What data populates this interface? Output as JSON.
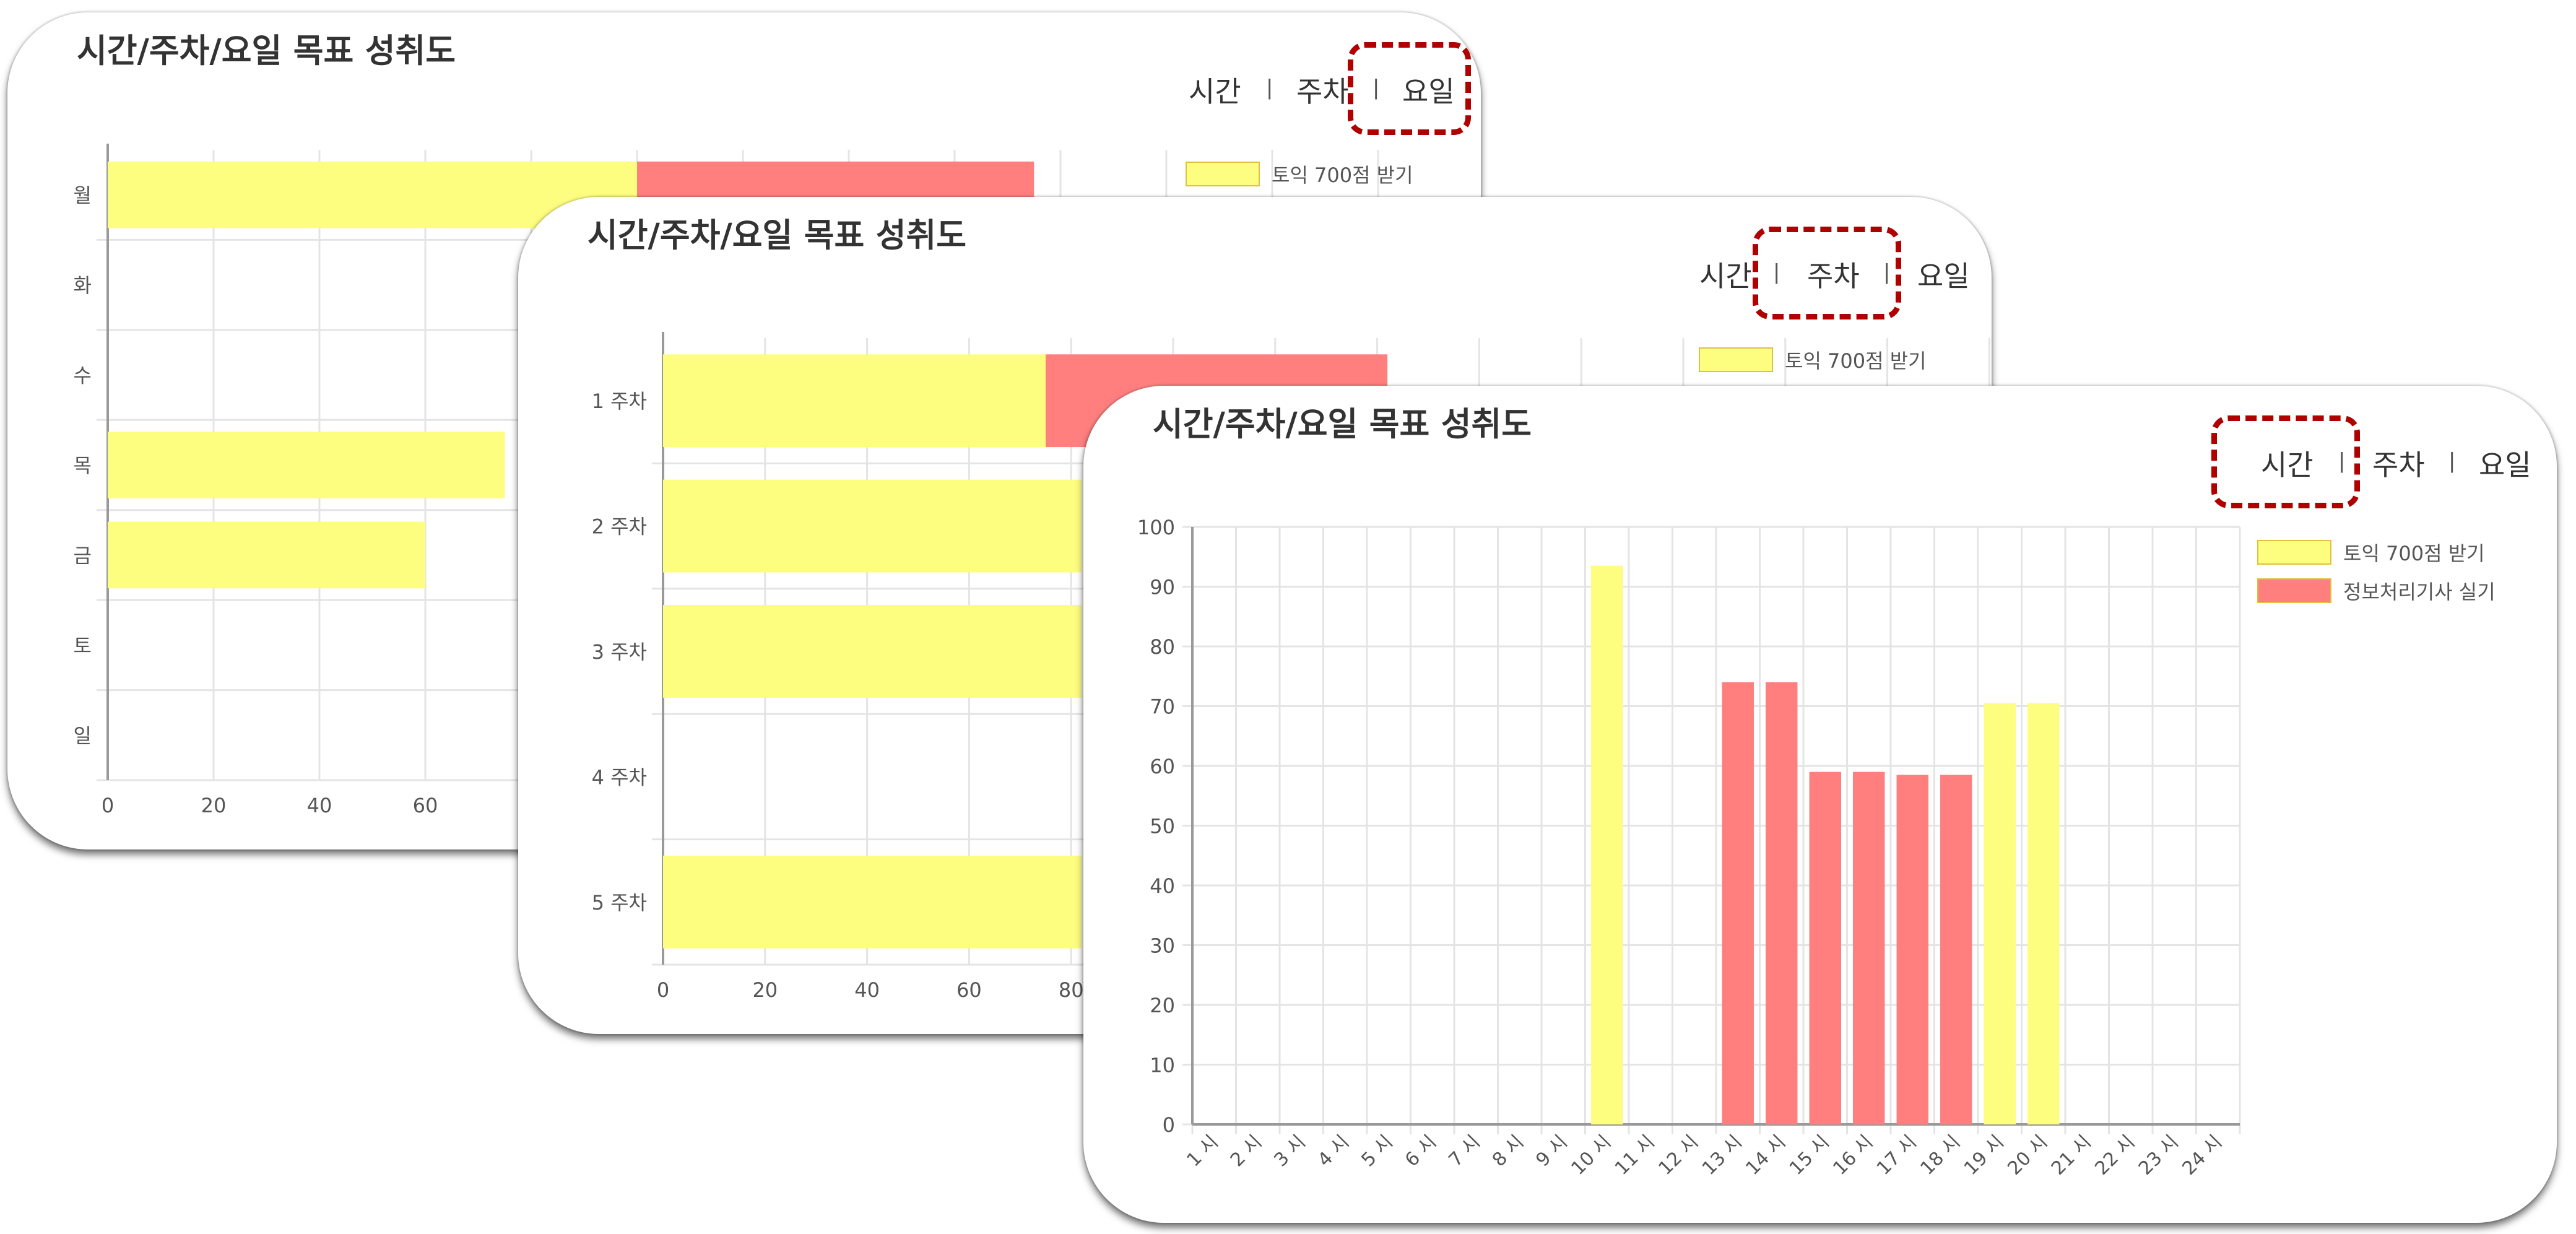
{
  "tabs": [
    "시간",
    "주차",
    "요일"
  ],
  "tab_separator": "|",
  "series": [
    {
      "name": "토익 700점 받기",
      "color": "#fdfd7f"
    },
    {
      "name": "정보처리기사 실기",
      "color": "#ff7f7f"
    }
  ],
  "cards": [
    {
      "title": "시간/주차/요일 목표 성취도",
      "active_tab": "요일"
    },
    {
      "title": "시간/주차/요일 목표 성취도",
      "active_tab": "주차"
    },
    {
      "title": "시간/주차/요일 목표 성취도",
      "active_tab": "시간"
    }
  ],
  "chart_data": [
    {
      "type": "bar",
      "orientation": "horizontal",
      "stacked": true,
      "categories": [
        "월",
        "화",
        "수",
        "목",
        "금",
        "토",
        "일"
      ],
      "series": [
        {
          "name": "토익 700점 받기",
          "values": [
            100,
            null,
            null,
            75,
            60,
            null,
            null
          ]
        },
        {
          "name": "정보처리기사 실기",
          "values": [
            75,
            null,
            null,
            null,
            null,
            null,
            null
          ]
        }
      ],
      "x_tick_labels": [
        "0",
        "20",
        "40",
        "60"
      ],
      "grid": true,
      "legend": "right",
      "note": "partially hidden by overlapping card"
    },
    {
      "type": "bar",
      "orientation": "horizontal",
      "stacked": true,
      "categories": [
        "1 주차",
        "2 주차",
        "3 주차",
        "4 주차",
        "5 주차"
      ],
      "series": [
        {
          "name": "토익 700점 받기",
          "values": [
            75,
            82,
            82,
            null,
            82
          ]
        },
        {
          "name": "정보처리기사 실기",
          "values": [
            67,
            null,
            null,
            null,
            null
          ]
        }
      ],
      "x_tick_labels": [
        "0",
        "20",
        "40",
        "60",
        "80"
      ],
      "grid": true,
      "legend": "right",
      "note": "partially hidden by overlapping card"
    },
    {
      "type": "bar",
      "orientation": "vertical",
      "categories": [
        "1 시",
        "2 시",
        "3 시",
        "4 시",
        "5 시",
        "6 시",
        "7 시",
        "8 시",
        "9 시",
        "10 시",
        "11 시",
        "12 시",
        "13 시",
        "14 시",
        "15 시",
        "16 시",
        "17 시",
        "18 시",
        "19 시",
        "20 시",
        "21 시",
        "22 시",
        "23 시",
        "24 시"
      ],
      "series": [
        {
          "name": "토익 700점 받기",
          "values": [
            0,
            0,
            0,
            0,
            0,
            0,
            0,
            0,
            0,
            93.5,
            0,
            0,
            0,
            0,
            0,
            0,
            0,
            0,
            70.5,
            70.5,
            0,
            0,
            0,
            0
          ]
        },
        {
          "name": "정보처리기사 실기",
          "values": [
            0,
            0,
            0,
            0,
            0,
            0,
            0,
            0,
            0,
            0,
            0,
            0,
            74,
            74,
            59,
            59,
            58.5,
            58.5,
            0,
            0,
            0,
            0,
            0,
            0
          ]
        }
      ],
      "ylim": [
        0,
        100
      ],
      "y_ticks": [
        0,
        10,
        20,
        30,
        40,
        50,
        60,
        70,
        80,
        90,
        100
      ],
      "grid": true,
      "legend": "top-right"
    }
  ]
}
